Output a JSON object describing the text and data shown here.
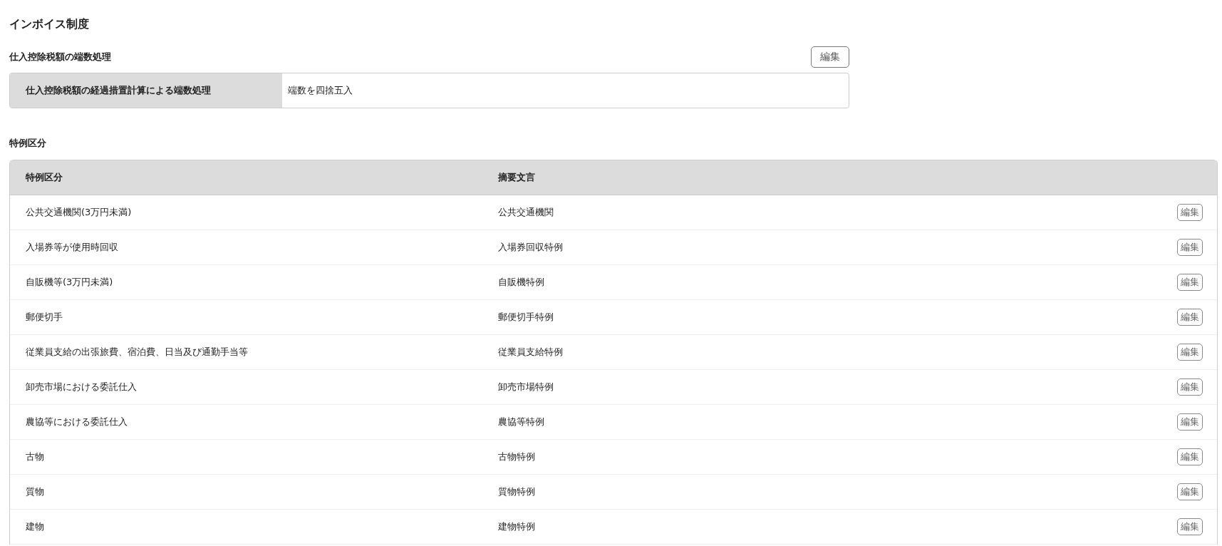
{
  "title": "インボイス制度",
  "rounding": {
    "heading": "仕入控除税額の端数処理",
    "edit_button": "編集",
    "label": "仕入控除税額の経過措置計算による端数処理",
    "value": "端数を四捨五入"
  },
  "special": {
    "heading": "特例区分",
    "columns": [
      "特例区分",
      "摘要文言"
    ],
    "rows": [
      {
        "category": "公共交通機関(3万円未満)",
        "summary": "公共交通機関",
        "edit_button": "編集"
      },
      {
        "category": "入場券等が使用時回収",
        "summary": "入場券回収特例",
        "edit_button": "編集"
      },
      {
        "category": "自販機等(3万円未満)",
        "summary": "自販機特例",
        "edit_button": "編集"
      },
      {
        "category": "郵便切手",
        "summary": "郵便切手特例",
        "edit_button": "編集"
      },
      {
        "category": "従業員支給の出張旅費、宿泊費、日当及び通勤手当等",
        "summary": "従業員支給特例",
        "edit_button": "編集"
      },
      {
        "category": "卸売市場における委託仕入",
        "summary": "卸売市場特例",
        "edit_button": "編集"
      },
      {
        "category": "農協等における委託仕入",
        "summary": "農協等特例",
        "edit_button": "編集"
      },
      {
        "category": "古物",
        "summary": "古物特例",
        "edit_button": "編集"
      },
      {
        "category": "質物",
        "summary": "質物特例",
        "edit_button": "編集"
      },
      {
        "category": "建物",
        "summary": "建物特例",
        "edit_button": "編集"
      }
    ]
  }
}
